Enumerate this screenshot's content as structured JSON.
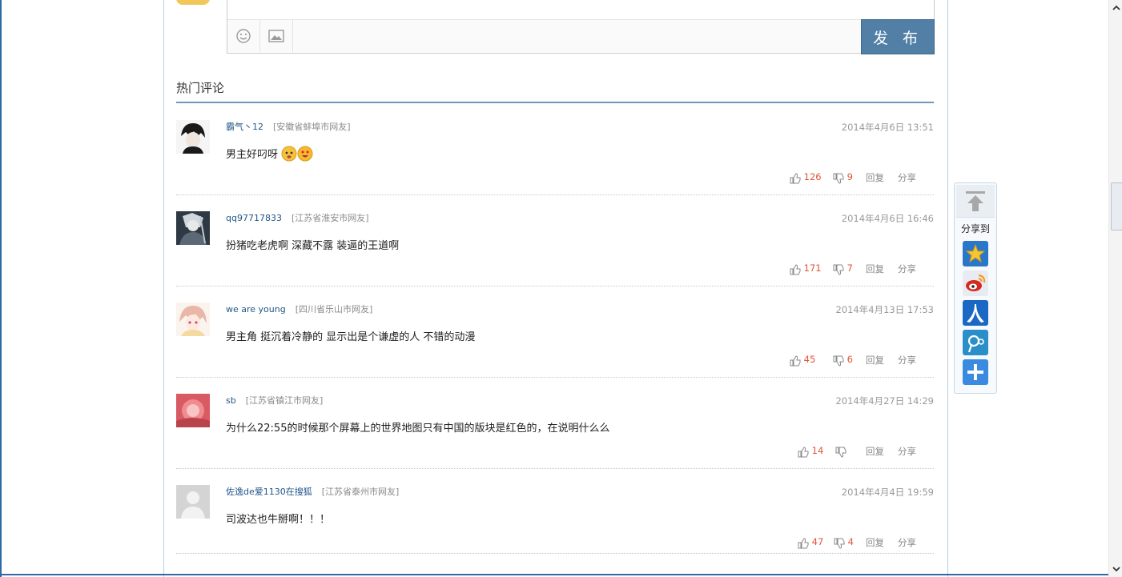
{
  "editor": {
    "publish_label": "发 布",
    "emoji_icon": "smiley-icon",
    "image_icon": "image-icon"
  },
  "section": {
    "title": "热门评论"
  },
  "comments": [
    {
      "username": "霸气丶12",
      "location": "[安徽省蚌埠市网友]",
      "time": "2014年4月6日 13:51",
      "content": "男主好叼呀",
      "likes": "126",
      "dislikes": "9",
      "reply": "回复",
      "share": "分享",
      "avatar_color": "#1a1a1a"
    },
    {
      "username": "qq97717833",
      "location": "[江苏省淮安市网友]",
      "time": "2014年4月6日 16:46",
      "content": "扮猪吃老虎啊 深藏不露 装逼的王道啊",
      "likes": "171",
      "dislikes": "7",
      "reply": "回复",
      "share": "分享",
      "avatar_color": "#34404c"
    },
    {
      "username": "we are young",
      "location": "[四川省乐山市网友]",
      "time": "2014年4月13日 17:53",
      "content": "男主角 挺沉着冷静的 显示出是个谦虚的人 不错的动漫",
      "likes": "45",
      "dislikes": "6",
      "reply": "回复",
      "share": "分享",
      "avatar_color": "#f2c3b3"
    },
    {
      "username": "sb",
      "location": "[江苏省镇江市网友]",
      "time": "2014年4月27日 14:29",
      "content": "为什么22:55的时候那个屏幕上的世界地图只有中国的版块是红色的，在说明什么么",
      "likes": "14",
      "dislikes": "",
      "reply": "回复",
      "share": "分享",
      "avatar_color": "#d85a62"
    },
    {
      "username": "佐逸de爱1130在搜狐",
      "location": "[江苏省泰州市网友]",
      "time": "2014年4月4日 19:59",
      "content": "司波达也牛掰啊！！！",
      "likes": "47",
      "dislikes": "4",
      "reply": "回复",
      "share": "分享",
      "avatar_color": "#cfcfcf"
    }
  ],
  "share_widget": {
    "label": "分享到",
    "icons": [
      {
        "name": "qzone-icon",
        "color": "#1f6fc2"
      },
      {
        "name": "weibo-icon",
        "color": "#d72a1e"
      },
      {
        "name": "renren-icon",
        "color": "#1a67c4"
      },
      {
        "name": "tencent-weibo-icon",
        "color": "#2a8fc9"
      },
      {
        "name": "more-share-icon",
        "color": "#3a8be0"
      }
    ]
  },
  "colors": {
    "accent": "#517fa6",
    "count": "#e0553a",
    "link": "#225588"
  }
}
